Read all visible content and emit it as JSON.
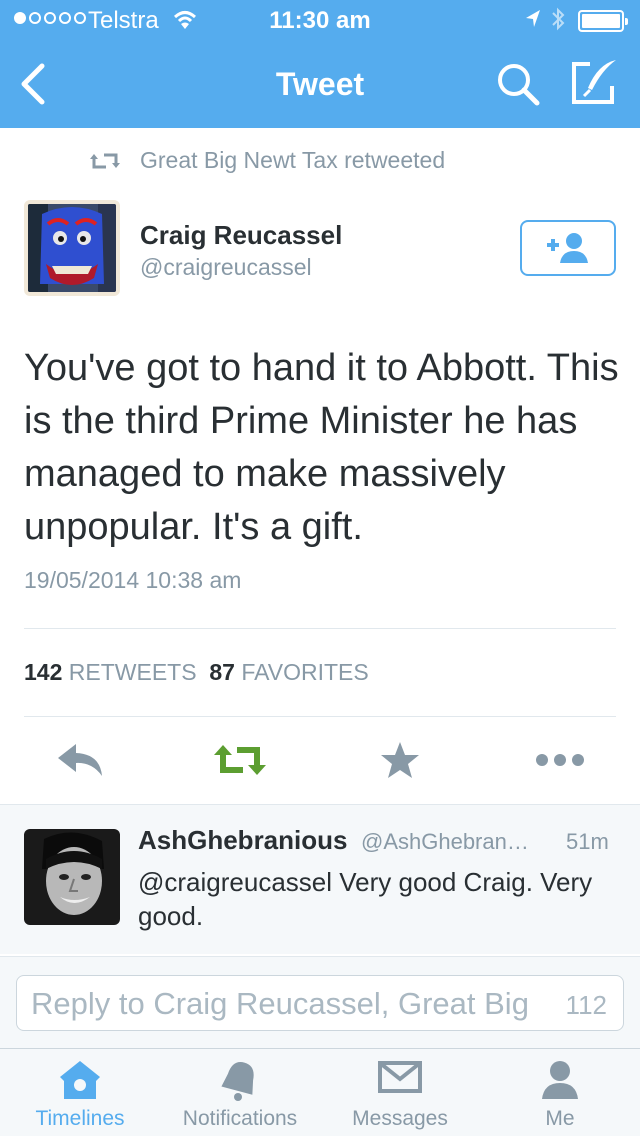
{
  "status_bar": {
    "carrier": "Telstra",
    "time": "11:30 am",
    "signal_bars_filled": 1,
    "signal_bars_total": 5,
    "battery_level": 1.0
  },
  "nav": {
    "title": "Tweet",
    "back_icon": "chevron-left-icon",
    "search_icon": "search-icon",
    "compose_icon": "compose-icon"
  },
  "retweet_context": {
    "text": "Great Big Newt Tax retweeted",
    "icon": "retweet-icon"
  },
  "tweet": {
    "author_name": "Craig Reucassel",
    "author_handle": "@craigreucassel",
    "text": "You've got to hand it to Abbott. This is the third Prime Minister he has managed to make massively unpopular. It's a gift.",
    "timestamp": "19/05/2014 10:38 am",
    "retweets_count": "142",
    "retweets_label": "RETWEETS",
    "favorites_count": "87",
    "favorites_label": "FAVORITES",
    "follow_icon": "add-user-icon"
  },
  "actions": {
    "reply_icon": "reply-icon",
    "retweet_icon": "retweet-icon",
    "favorite_icon": "star-icon",
    "more_icon": "more-icon"
  },
  "reply": {
    "name": "AshGhebranious",
    "handle": "@AshGhebran…",
    "time": "51m",
    "text": "@craigreucassel Very good Craig. Very good."
  },
  "composer": {
    "placeholder": "Reply to Craig Reucassel, Great Big",
    "char_count": "112"
  },
  "tabbar": {
    "tabs": [
      {
        "label": "Timelines",
        "icon": "home-icon",
        "active": true
      },
      {
        "label": "Notifications",
        "icon": "bell-icon",
        "active": false
      },
      {
        "label": "Messages",
        "icon": "envelope-icon",
        "active": false
      },
      {
        "label": "Me",
        "icon": "person-icon",
        "active": false
      }
    ]
  },
  "colors": {
    "brand": "#55acee",
    "retweet_green": "#5c9e31",
    "muted": "#8899a6",
    "icon_gray": "#8899a6"
  }
}
